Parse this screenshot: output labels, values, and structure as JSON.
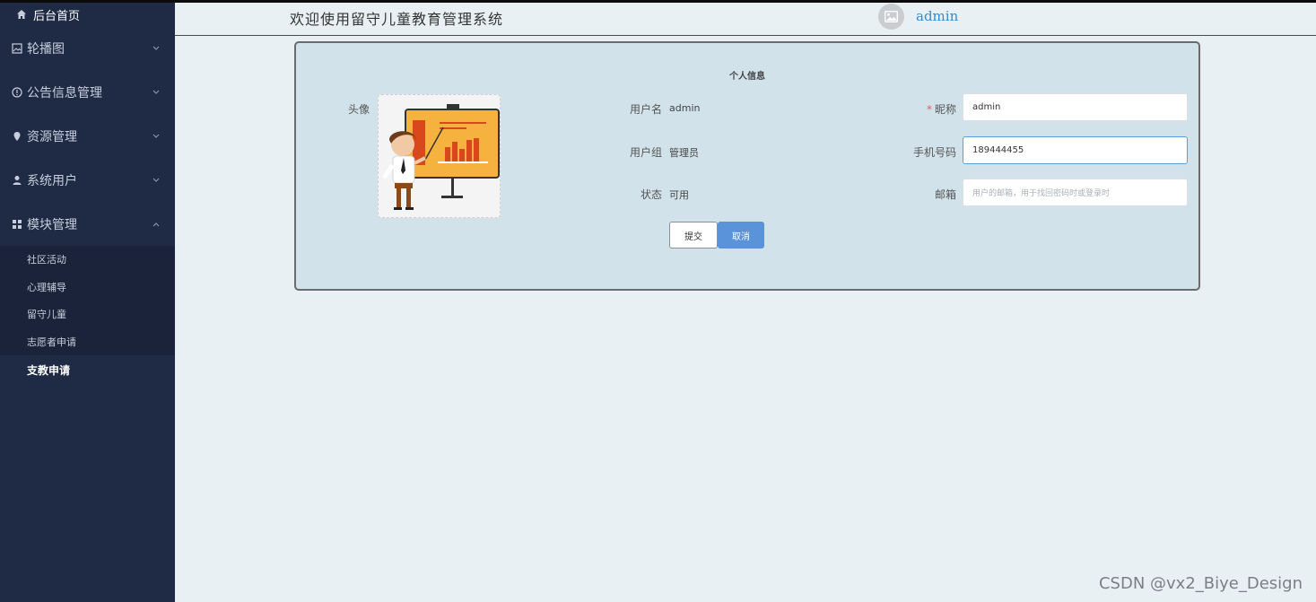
{
  "sidebar": {
    "home": "后台首页",
    "items": [
      {
        "label": "轮播图",
        "icon": "image-icon"
      },
      {
        "label": "公告信息管理",
        "icon": "info-circle-icon"
      },
      {
        "label": "资源管理",
        "icon": "location-pin-icon"
      },
      {
        "label": "系统用户",
        "icon": "user-icon"
      },
      {
        "label": "模块管理",
        "icon": "grid-icon",
        "expanded": true
      }
    ],
    "submenu": [
      {
        "label": "社区活动"
      },
      {
        "label": "心理辅导"
      },
      {
        "label": "留守儿童"
      },
      {
        "label": "志愿者申请"
      },
      {
        "label": "支教申请",
        "active": true
      }
    ]
  },
  "header": {
    "title": "欢迎使用留守儿童教育管理系统",
    "username": "admin"
  },
  "profile": {
    "title": "个人信息",
    "avatar_label": "头像",
    "username_label": "用户名",
    "username_value": "admin",
    "group_label": "用户组",
    "group_value": "管理员",
    "status_label": "状态",
    "status_value": "可用",
    "nickname_label": "昵称",
    "nickname_value": "admin",
    "phone_label": "手机号码",
    "phone_value": "189444455",
    "email_label": "邮箱",
    "email_placeholder": "用户的邮箱，用于找回密码时或登录时",
    "submit_label": "提交",
    "cancel_label": "取消"
  },
  "colors": {
    "sidebar_bg": "#1f2a44",
    "card_bg": "#d1e2ea",
    "accent": "#5a93da",
    "username_link": "#2e8bd6"
  },
  "watermark": "CSDN @vx2_Biye_Design"
}
